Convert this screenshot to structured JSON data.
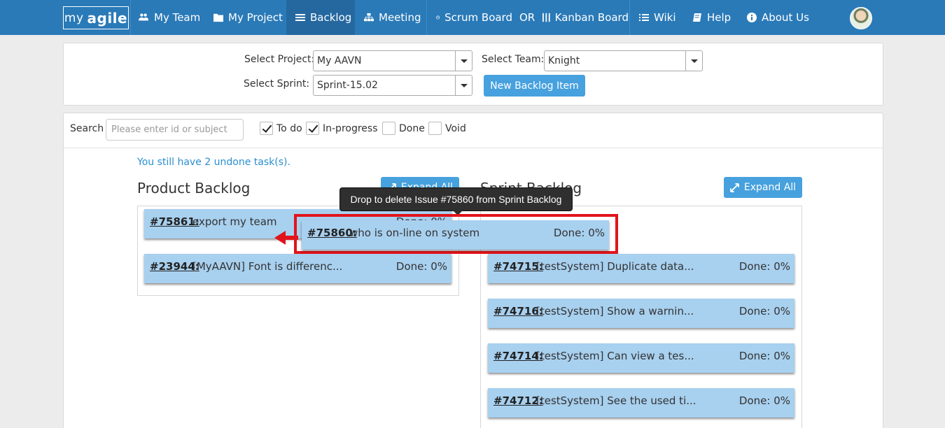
{
  "nav": {
    "logo_my": "my",
    "logo_agile": "agile",
    "items": [
      {
        "label": "My Team",
        "icon": "users-icon"
      },
      {
        "label": "My Project",
        "icon": "folder-icon"
      },
      {
        "label": "Backlog",
        "icon": "list-icon"
      },
      {
        "label": "Meeting",
        "icon": "sitemap-icon"
      },
      {
        "label": "Scrum Board",
        "icon": "clock-icon"
      },
      {
        "label": "OR",
        "icon": ""
      },
      {
        "label": "Kanban Board",
        "icon": "columns-icon"
      },
      {
        "label": "Wiki",
        "icon": "list-icon"
      },
      {
        "label": "Help",
        "icon": "book-icon"
      },
      {
        "label": "About Us",
        "icon": "info-icon"
      }
    ],
    "active": "Backlog"
  },
  "filters": {
    "project_label": "Select Project:",
    "project_value": "My AAVN",
    "team_label": "Select Team:",
    "team_value": "Knight",
    "sprint_label": "Select Sprint:",
    "sprint_value": "Sprint-15.02",
    "new_item_label": "New Backlog Item"
  },
  "search": {
    "label": "Search",
    "placeholder": "Please enter id or subject",
    "checkboxes": [
      {
        "label": "To do",
        "checked": true
      },
      {
        "label": "In-progress",
        "checked": true
      },
      {
        "label": "Done",
        "checked": false
      },
      {
        "label": "Void",
        "checked": false
      }
    ]
  },
  "notice": "You still have 2 undone task(s).",
  "product_backlog": {
    "title": "Product Backlog",
    "expand_label": "Expand All",
    "items": [
      {
        "id": "#75861:",
        "title": "export my team",
        "done": "Done: 0%"
      },
      {
        "id": "#23944:",
        "title": "[MyAAVN] Font is differenc...",
        "done": "Done: 0%"
      }
    ]
  },
  "sprint_backlog": {
    "title": "Sprint Backlog",
    "expand_label": "Expand All",
    "items": [
      {
        "id": "#74715:",
        "title": "[testSystem] Duplicate data...",
        "done": "Done: 0%"
      },
      {
        "id": "#74716:",
        "title": "[testSystem] Show a warnin...",
        "done": "Done: 0%"
      },
      {
        "id": "#74714:",
        "title": "[testSystem] Can view a tes...",
        "done": "Done: 0%"
      },
      {
        "id": "#74712:",
        "title": "[testSystem] See the used ti...",
        "done": "Done: 0%"
      }
    ]
  },
  "dragging": {
    "id": "#75860:",
    "title": "who is on-line on system",
    "done": "Done: 0%",
    "tooltip": "Drop to delete Issue #75860 from Sprint Backlog"
  },
  "colors": {
    "navbar": "#2a7ab8",
    "button": "#46a1de",
    "card": "#a8d0ef",
    "highlight": "#e2141b"
  }
}
